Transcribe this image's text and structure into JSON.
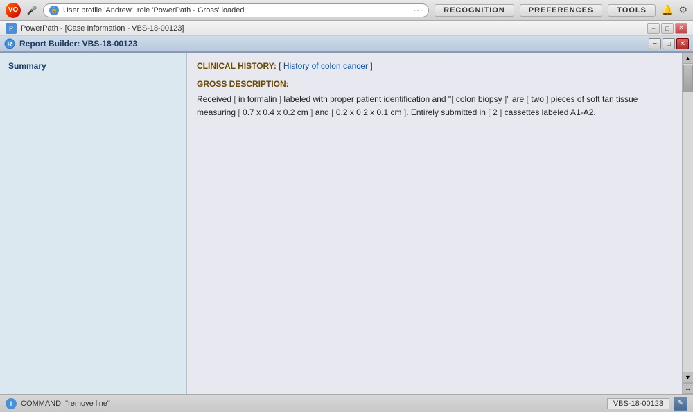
{
  "browser": {
    "logo_text": "VO",
    "address": "User profile 'Andrew', role 'PowerPath - Gross' loaded",
    "nav_buttons": [
      "RECOGNITION",
      "PREFERENCES",
      "TOOLS"
    ],
    "window_controls": [
      "−",
      "□",
      "✕"
    ]
  },
  "app": {
    "title": "PowerPath - [Case Information - VBS-18-00123]",
    "icon_text": "P",
    "window_controls": [
      "−",
      "□",
      "✕"
    ]
  },
  "report_builder": {
    "title": "Report Builder: VBS-18-00123",
    "window_controls": [
      "−",
      "□",
      "✕"
    ]
  },
  "sidebar": {
    "items": [
      {
        "label": "Summary"
      }
    ]
  },
  "content": {
    "clinical_history": {
      "label": "CLINICAL HISTORY:",
      "bracket_open": "[",
      "value": "History of colon cancer",
      "bracket_close": "]"
    },
    "gross_description": {
      "label": "GROSS DESCRIPTION:",
      "line1_parts": [
        {
          "type": "text",
          "value": "Received "
        },
        {
          "type": "bracket",
          "value": "["
        },
        {
          "type": "text",
          "value": " in formalin "
        },
        {
          "type": "bracket",
          "value": "]"
        },
        {
          "type": "text",
          "value": " labeled with proper patient identification and \""
        },
        {
          "type": "bracket",
          "value": "["
        },
        {
          "type": "text",
          "value": " colon biopsy "
        },
        {
          "type": "bracket",
          "value": "]"
        },
        {
          "type": "text",
          "value": "\" are "
        },
        {
          "type": "bracket",
          "value": "["
        },
        {
          "type": "text",
          "value": " two "
        },
        {
          "type": "bracket",
          "value": "]"
        },
        {
          "type": "text",
          "value": " pieces of soft tan tissue"
        }
      ],
      "line2_parts": [
        {
          "type": "text",
          "value": "measuring "
        },
        {
          "type": "bracket",
          "value": "["
        },
        {
          "type": "text",
          "value": " 0.7 x 0.4 x 0.2 cm "
        },
        {
          "type": "bracket",
          "value": "]"
        },
        {
          "type": "text",
          "value": " and "
        },
        {
          "type": "bracket",
          "value": "["
        },
        {
          "type": "text",
          "value": " 0.2 x 0.2 x 0.1 cm "
        },
        {
          "type": "bracket",
          "value": "]"
        },
        {
          "type": "text",
          "value": ". Entirely submitted in "
        },
        {
          "type": "bracket",
          "value": "["
        },
        {
          "type": "text",
          "value": " 2 "
        },
        {
          "type": "bracket",
          "value": "]"
        },
        {
          "type": "text",
          "value": " cassettes labeled A1-A2."
        }
      ]
    }
  },
  "status_bar": {
    "icon_text": "i",
    "command_text": "COMMAND: \"remove line\"",
    "case_id": "VBS-18-00123",
    "edit_icon": "✎"
  }
}
